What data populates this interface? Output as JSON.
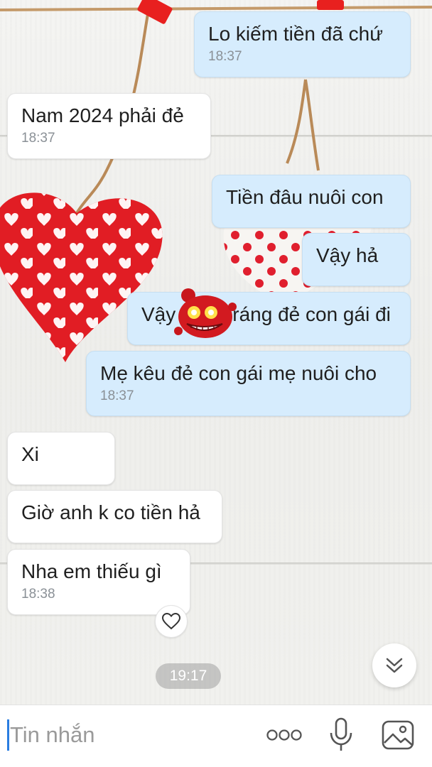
{
  "messages": [
    {
      "id": "m1",
      "side": "me",
      "text": "Lo kiếm tiền đã chứ",
      "time": "18:37"
    },
    {
      "id": "m2",
      "side": "them",
      "text": "Nam 2024 phải đẻ",
      "time": "18:37"
    },
    {
      "id": "m3",
      "side": "me",
      "text": "Tiền đâu nuôi con",
      "time": ""
    },
    {
      "id": "m4",
      "side": "me",
      "text": "Vậy hả",
      "time": ""
    },
    {
      "id": "m5",
      "side": "me",
      "text": "Vậy thì ráng đẻ con gái đi",
      "text_visible_left": "Vậy",
      "text_visible_right": "ráng đẻ con gái đi",
      "time": ""
    },
    {
      "id": "m6",
      "side": "me",
      "text": "Mẹ kêu đẻ con gái mẹ nuôi cho",
      "time": "18:37"
    },
    {
      "id": "m7",
      "side": "them",
      "text": "Xi",
      "time": ""
    },
    {
      "id": "m8",
      "side": "them",
      "text": "Giờ anh k co tiền hả",
      "time": ""
    },
    {
      "id": "m9",
      "side": "them",
      "text": "Nha em thiếu gì",
      "time": "18:38"
    }
  ],
  "date_chip": "19:17",
  "composer": {
    "placeholder": "Tin nhắn"
  },
  "icons": {
    "sticker": "grinning-red-creature-sticker",
    "reaction": "heart-outline-icon",
    "scroll": "double-chevron-down-icon",
    "more": "more-dots-icon",
    "mic": "microphone-icon",
    "image": "image-icon"
  },
  "colors": {
    "my_bubble": "#d6ecfd",
    "their_bubble": "#ffffff",
    "accent": "#2a7de1"
  }
}
